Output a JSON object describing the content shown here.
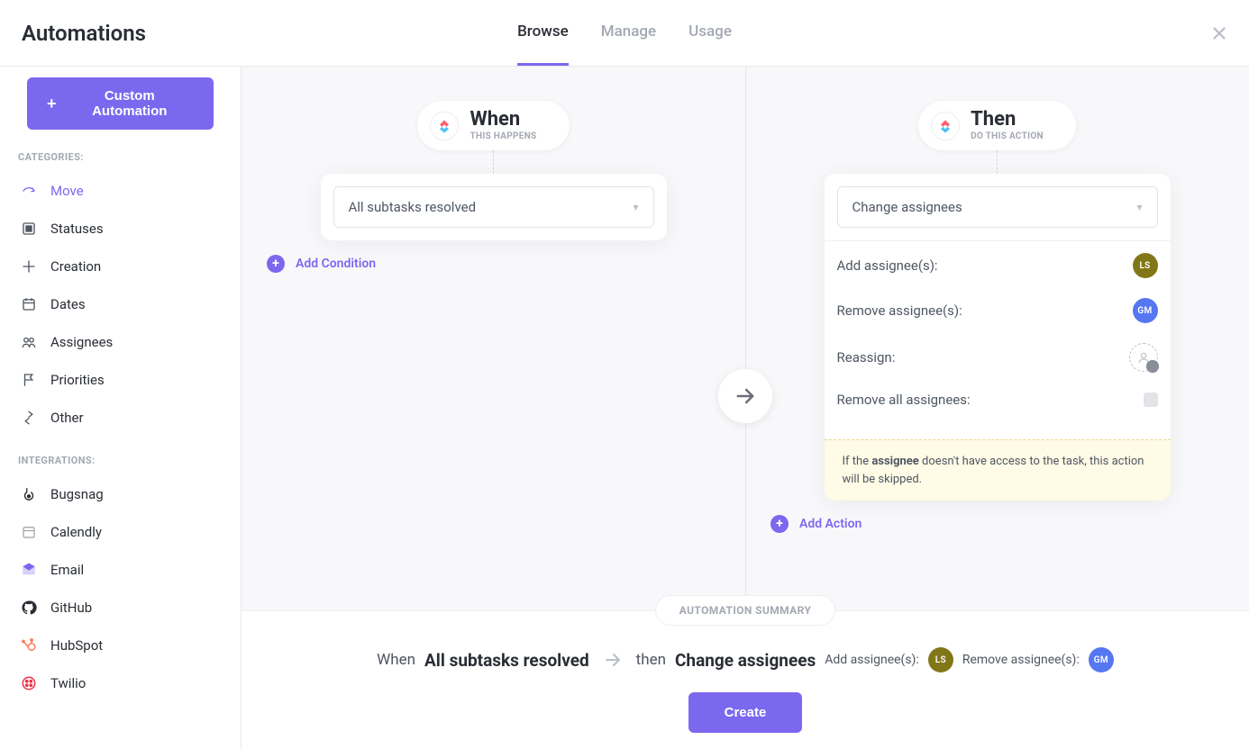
{
  "header": {
    "title": "Automations",
    "tabs": [
      {
        "label": "Browse",
        "active": true
      },
      {
        "label": "Manage",
        "active": false
      },
      {
        "label": "Usage",
        "active": false
      }
    ]
  },
  "sidebar": {
    "custom_button": "Custom Automation",
    "categories_label": "CATEGORIES:",
    "categories": [
      {
        "label": "Move",
        "icon": "move"
      },
      {
        "label": "Statuses",
        "icon": "statuses"
      },
      {
        "label": "Creation",
        "icon": "creation"
      },
      {
        "label": "Dates",
        "icon": "dates"
      },
      {
        "label": "Assignees",
        "icon": "assignees"
      },
      {
        "label": "Priorities",
        "icon": "priorities"
      },
      {
        "label": "Other",
        "icon": "other"
      }
    ],
    "integrations_label": "INTEGRATIONS:",
    "integrations": [
      {
        "label": "Bugsnag",
        "icon": "bugsnag"
      },
      {
        "label": "Calendly",
        "icon": "calendly"
      },
      {
        "label": "Email",
        "icon": "email"
      },
      {
        "label": "GitHub",
        "icon": "github"
      },
      {
        "label": "HubSpot",
        "icon": "hubspot"
      },
      {
        "label": "Twilio",
        "icon": "twilio"
      }
    ]
  },
  "when": {
    "title": "When",
    "subtitle": "THIS HAPPENS",
    "trigger": "All subtasks resolved",
    "add_condition": "Add Condition"
  },
  "then": {
    "title": "Then",
    "subtitle": "DO THIS ACTION",
    "action": "Change assignees",
    "rows": {
      "add": "Add assignee(s):",
      "remove": "Remove assignee(s):",
      "reassign": "Reassign:",
      "remove_all": "Remove all assignees:"
    },
    "avatars": {
      "add": "LS",
      "remove": "GM"
    },
    "notice_pre": "If the ",
    "notice_bold": "assignee",
    "notice_post": " doesn't have access to the task, this action will be skipped.",
    "add_action": "Add Action"
  },
  "summary": {
    "pill": "AUTOMATION SUMMARY",
    "when_word": "When",
    "when_value": "All subtasks resolved",
    "then_word": "then",
    "then_value": "Change assignees",
    "add_label": "Add assignee(s):",
    "remove_label": "Remove assignee(s):",
    "avatars": {
      "add": "LS",
      "remove": "GM"
    },
    "create": "Create"
  },
  "colors": {
    "accent": "#7b68ee",
    "avatar_olive": "#827718",
    "avatar_blue": "#5577f1"
  }
}
